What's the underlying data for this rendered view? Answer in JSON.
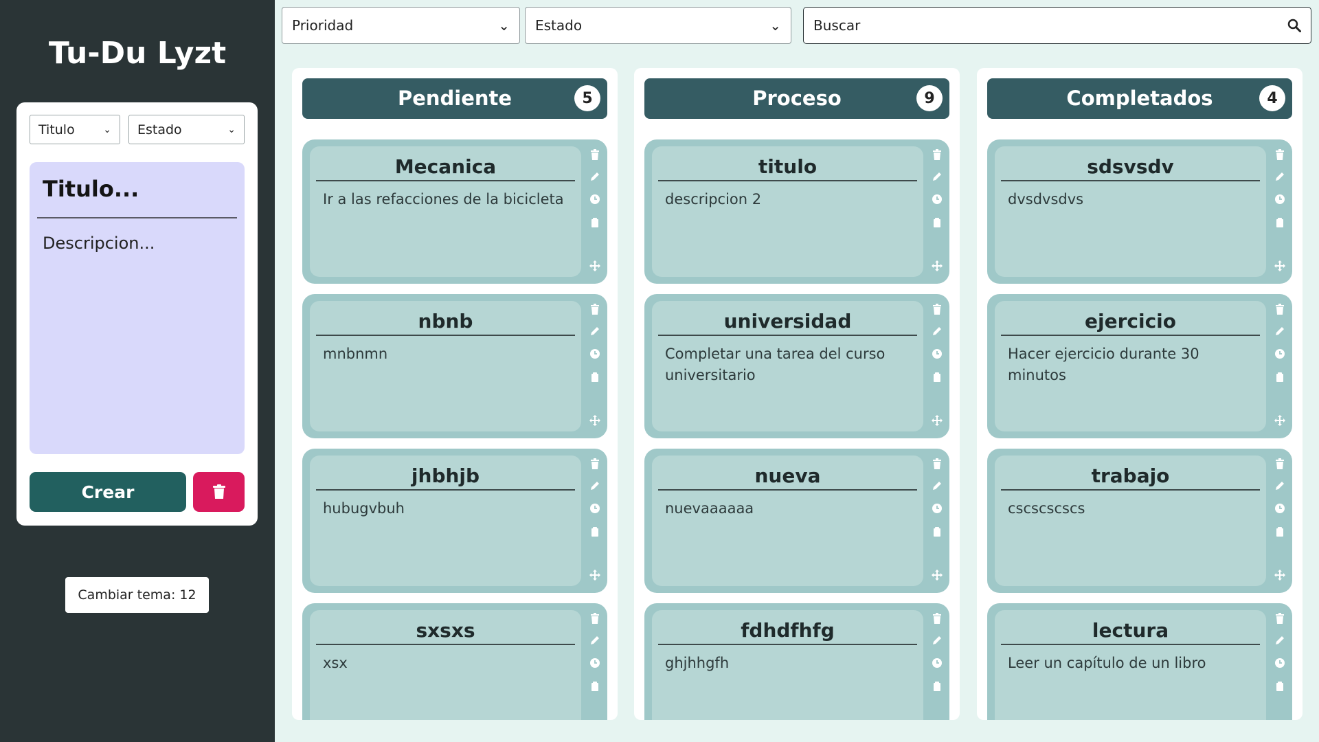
{
  "app": {
    "title": "Tu-Du Lyzt"
  },
  "form": {
    "filter_title": "Titulo",
    "filter_status": "Estado",
    "title_placeholder": "Titulo...",
    "description_placeholder": "Descripcion...",
    "create_label": "Crear"
  },
  "theme": {
    "label": "Cambiar tema: 12"
  },
  "toolbar": {
    "priority_select": "Prioridad",
    "status_select": "Estado",
    "search_placeholder": "Buscar"
  },
  "columns": [
    {
      "title": "Pendiente",
      "count": "5",
      "tasks": [
        {
          "title": "Mecanica",
          "description": "Ir a las refacciones de la bicicleta"
        },
        {
          "title": "nbnb",
          "description": "mnbnmn"
        },
        {
          "title": "jhbhjb",
          "description": "hubugvbuh"
        },
        {
          "title": "sxsxs",
          "description": "xsx"
        }
      ]
    },
    {
      "title": "Proceso",
      "count": "9",
      "tasks": [
        {
          "title": "titulo",
          "description": "descripcion 2"
        },
        {
          "title": "universidad",
          "description": "Completar una tarea del curso universitario"
        },
        {
          "title": "nueva",
          "description": "nuevaaaaaa"
        },
        {
          "title": "fdhdfhfg",
          "description": "ghjhhgfh"
        }
      ]
    },
    {
      "title": "Completados",
      "count": "4",
      "tasks": [
        {
          "title": "sdsvsdv",
          "description": "dvsdvsdvs"
        },
        {
          "title": "ejercicio",
          "description": "Hacer ejercicio durante 30 minutos"
        },
        {
          "title": "trabajo",
          "description": "cscscscscs"
        },
        {
          "title": "lectura",
          "description": "Leer un capítulo de un libro"
        }
      ]
    }
  ],
  "icons": {
    "task_actions": [
      "trash-icon",
      "pencil-icon",
      "clock-icon",
      "clipboard-icon",
      "move-icon"
    ],
    "search": "search-icon",
    "delete": "trash-icon"
  },
  "colors": {
    "sidebar": "#2a3436",
    "create_button": "#22605f",
    "delete_button": "#d91a5d",
    "column_header": "#355c63",
    "task_card": "#b6d6d4",
    "note_area": "#d9d9fb"
  }
}
